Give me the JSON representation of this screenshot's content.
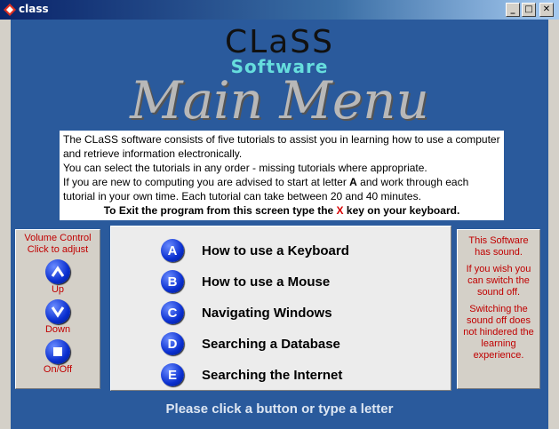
{
  "window": {
    "title": "class",
    "minimize": "_",
    "maximize": "□",
    "close": "✕"
  },
  "logo": {
    "class_text": "CLaSS",
    "software_text": "Software"
  },
  "heading": "Main Menu",
  "intro": {
    "line1": "The CLaSS software consists of five tutorials to assist you in learning how to use a computer and retrieve information electronically.",
    "line2": "You can select the tutorials in any order - missing tutorials where appropriate.",
    "line3_pre": "If you are new to computing you are advised to start at letter ",
    "line3_letter": "A",
    "line3_post": " and work through each tutorial in your own time. Each tutorial can take between 20 and 40 minutes.",
    "exit_pre": "To Exit the program from this screen type the ",
    "exit_key": "X",
    "exit_post": " key on your keyboard."
  },
  "volume": {
    "title_line1": "Volume Control",
    "title_line2": "Click to adjust",
    "up_label": "Up",
    "down_label": "Down",
    "onoff_label": "On/Off"
  },
  "menu": [
    {
      "letter": "A",
      "label": "How to use a Keyboard"
    },
    {
      "letter": "B",
      "label": "How to use a Mouse"
    },
    {
      "letter": "C",
      "label": "Navigating Windows"
    },
    {
      "letter": "D",
      "label": "Searching a Database"
    },
    {
      "letter": "E",
      "label": "Searching the Internet"
    }
  ],
  "sound_info": {
    "p1": "This Software has sound.",
    "p2": "If you wish you can switch the sound off.",
    "p3": "Switching the sound off does not hindered the learning experience."
  },
  "footer": "Please click a button or type a letter",
  "colors": {
    "background": "#2a5a9c",
    "accent_red": "#c00000",
    "button_blue": "#0a2fd0"
  }
}
